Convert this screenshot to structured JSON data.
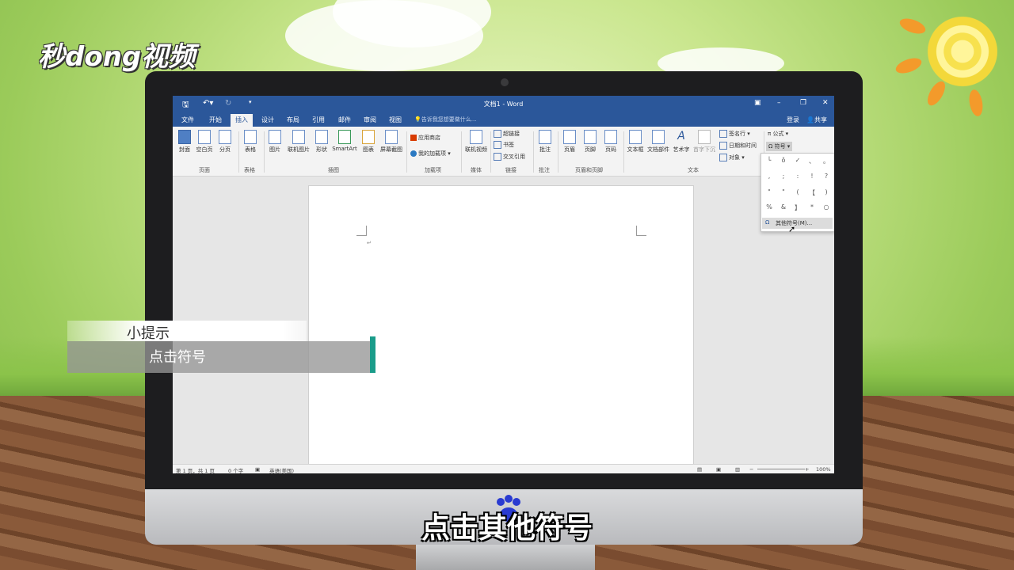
{
  "brand": {
    "logo_text": "秒dong视频"
  },
  "window": {
    "title": "文档1 - Word"
  },
  "tabs": [
    "文件",
    "开始",
    "插入",
    "设计",
    "布局",
    "引用",
    "邮件",
    "审阅",
    "视图"
  ],
  "tell_me": "告诉我您想要做什么...",
  "account": {
    "login": "登录",
    "share": "共享"
  },
  "ribbon": {
    "buttons": {
      "cover": "封面",
      "blank": "空白页",
      "pagebreak": "分页",
      "table": "表格",
      "picture": "图片",
      "online_picture": "联机图片",
      "shapes": "形状",
      "smartart": "SmartArt",
      "chart": "图表",
      "screenshot": "屏幕截图",
      "store": "应用商店",
      "my_addins": "我的加载项",
      "online_video": "联机视频",
      "hyperlink": "超链接",
      "bookmark": "书签",
      "crossref": "交叉引用",
      "comment": "批注",
      "header": "页眉",
      "footer": "页脚",
      "page_number": "页码",
      "textbox": "文本框",
      "quickparts": "文档部件",
      "wordart": "艺术字",
      "dropcap": "首字下沉",
      "signature": "签名行",
      "datetime": "日期和时间",
      "object": "对象",
      "equation": "公式",
      "symbol": "符号"
    },
    "groups": {
      "pages": "页面",
      "tables": "表格",
      "illustrations": "插图",
      "addins": "加载项",
      "media": "媒体",
      "links": "链接",
      "comments": "批注",
      "header_footer": "页眉和页脚",
      "text": "文本"
    }
  },
  "symbol_menu": {
    "symbols": [
      "└",
      "ǒ",
      "✓",
      "、",
      "。",
      ",",
      ";",
      ":",
      "!",
      "?",
      "\"",
      "\"",
      "(",
      "【",
      ")",
      "%",
      "&",
      "】",
      "*",
      "○"
    ],
    "more_label": "其他符号(M)..."
  },
  "statusbar": {
    "page": "第 1 页，共 1 页",
    "words": "0 个字",
    "language": "英语(美国)",
    "zoom": "100%"
  },
  "overlay": {
    "tip_title": "小提示",
    "tip_body": "点击符号",
    "subtitle": "点击其他符号"
  }
}
